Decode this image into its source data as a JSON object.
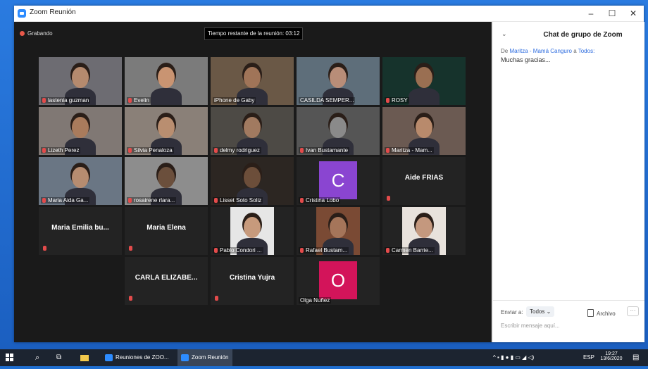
{
  "window": {
    "title": "Zoom Reunión",
    "minimize": "–",
    "maximize": "☐",
    "close": "✕"
  },
  "meeting": {
    "recording": "Grabando",
    "time_remaining": "Tiempo restante de la reunión: 03:12"
  },
  "tiles": [
    {
      "name": "lastenia guzman",
      "kind": "video",
      "skin": "#b58a6e",
      "bg": "#6d6c72"
    },
    {
      "name": "Evelin",
      "kind": "video",
      "skin": "#c99472",
      "bg": "#7b7b7b"
    },
    {
      "name": "iPhone de Gaby",
      "kind": "video",
      "skin": "#a07458",
      "bg": "#6a5846"
    },
    {
      "name": "CASILDA SEMPER...",
      "kind": "video",
      "skin": "#b88d78",
      "bg": "#5e6e7a",
      "highlight": true
    },
    {
      "name": "ROSY",
      "kind": "video",
      "skin": "#9a6f52",
      "bg": "#16332c"
    },
    {
      "name": "Lizeth Perez",
      "kind": "video",
      "skin": "#a97b5c",
      "bg": "#807874"
    },
    {
      "name": "Silvia Penaloza",
      "kind": "video",
      "skin": "#b98e70",
      "bg": "#8a8078"
    },
    {
      "name": "delmy rodriguez",
      "kind": "video",
      "skin": "#a17a60",
      "bg": "#4d4a45"
    },
    {
      "name": "Ivan Bustamante",
      "kind": "video",
      "skin": "#8a8a8a",
      "bg": "#555"
    },
    {
      "name": "Maritza - Mam...",
      "kind": "video",
      "skin": "#b88a6c",
      "bg": "#6b5a52"
    },
    {
      "name": "Maria Aida Ga...",
      "kind": "video",
      "skin": "#b68c70",
      "bg": "#6a7684"
    },
    {
      "name": "rosairene rlara...",
      "kind": "video",
      "skin": "#6b4f3c",
      "bg": "#8d8d8d"
    },
    {
      "name": "Lisset Soto Soliz",
      "kind": "video",
      "skin": "#6c4e3a",
      "bg": "#2c2622"
    },
    {
      "name": "Cristina Lobo",
      "kind": "avatar",
      "letter": "C",
      "color": "#8a45d1"
    },
    {
      "name": "Aide FRIAS",
      "kind": "text"
    },
    {
      "name": "Maria Emilia bu...",
      "kind": "text"
    },
    {
      "name": "Maria Elena",
      "kind": "text"
    },
    {
      "name": "Pablo Condori ...",
      "kind": "photo",
      "skin": "#c79a7c",
      "bg": "#e6e6e6"
    },
    {
      "name": "Rafael Bustam...",
      "kind": "photo",
      "skin": "#a5755a",
      "bg": "#7a4a34"
    },
    {
      "name": "Carmen Barrie...",
      "kind": "photo",
      "skin": "#c4987e",
      "bg": "#e8e2dc"
    },
    {
      "name": "CARLA ELIZABE...",
      "kind": "text"
    },
    {
      "name": "Cristina Yujra",
      "kind": "text"
    },
    {
      "name": "Olga Nuñez",
      "kind": "avatar",
      "letter": "O",
      "color": "#d3145a"
    }
  ],
  "chat": {
    "title": "Chat de grupo de Zoom",
    "msg_prefix": "De",
    "msg_from": "Maritza - Mamá Canguro",
    "msg_to_word": "a",
    "msg_to": "Todos:",
    "msg_text": "Muchas gracias...",
    "send_to_label": "Enviar a:",
    "recipient": "Todos ⌄",
    "file_label": "Archivo",
    "more": "···",
    "input_placeholder": "Escribir mensaje aquí..."
  },
  "taskbar": {
    "app1": "Reuniones de ZOO...",
    "app2": "Zoom Reunión",
    "lang": "ESP",
    "time": "19:27",
    "date": "13/6/2020"
  }
}
